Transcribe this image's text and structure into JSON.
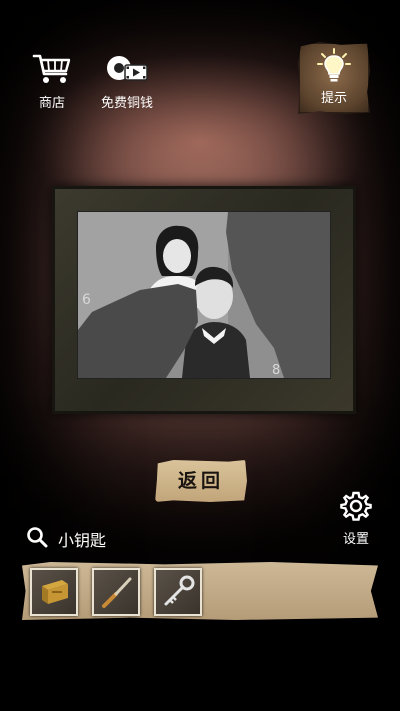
{
  "top_bar": {
    "shop_label": "商店",
    "coins_label": "免费铜钱",
    "hint_label": "提示"
  },
  "photo": {
    "chalk_numbers": [
      "6",
      "8"
    ]
  },
  "return_label": "返回",
  "settings_label": "设置",
  "selected_item_name": "小钥匙",
  "inventory": {
    "items": [
      {
        "icon": "brass-plate-icon"
      },
      {
        "icon": "knife-icon"
      },
      {
        "icon": "small-key-icon"
      }
    ]
  }
}
